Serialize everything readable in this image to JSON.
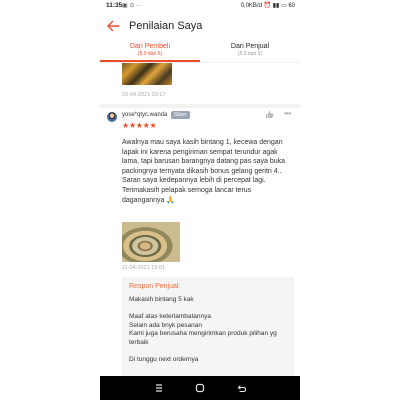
{
  "status_bar": {
    "time": "11:35",
    "left_icons": "▣ ⊙ ···",
    "right_text": "0,0KB/d ⏰ ▮▮ ▭ 60"
  },
  "header": {
    "title": "Penilaian Saya"
  },
  "tabs": [
    {
      "label": "Dari Pembeli",
      "sub": "(5.0 dari 5)",
      "active": true
    },
    {
      "label": "Dari Penjual",
      "sub": "(5.0 dari 5)",
      "active": false
    }
  ],
  "previous_review": {
    "timestamp": "20-04-2021 20:17"
  },
  "review": {
    "username": "yose*qtyc.wanda",
    "badge": "Silver",
    "stars": "★★★★★",
    "rating": 5,
    "text": "Awalnya mau saya kasih bintang 1, kecewa dengan lapak ini karena pengiriman sempat terundur agak lama, tapi barusan barangnya datang pas saya buka packingnya ternyata dikasih bonus gelang geritri 4.. Saran saya kedepannya lebih di percepat lagi. Terimakasih pelapak semoga lancar terus dagangannya 🙏",
    "timestamp": "11-04-2021 15:01"
  },
  "seller_response": {
    "label": "Respon Penjual:",
    "lines": [
      "Makasih bintang 5 kak",
      "Maaf atas keterlambatannya",
      "Selain ada bnyk pesanan",
      "Kami juga berusaha mengirimkan produk pilihan yg terbaik",
      "Di tunggu next ordernya"
    ]
  },
  "icons": {
    "back": "arrow-left-icon",
    "like": "thumbs-up-icon",
    "more": "more-options-icon",
    "nav_recents": "recents-icon",
    "nav_home": "home-icon",
    "nav_back": "nav-back-icon"
  },
  "colors": {
    "accent": "#ee4d2d",
    "seller_label": "#e76f3d",
    "badge_bg": "#9aa5b5"
  }
}
